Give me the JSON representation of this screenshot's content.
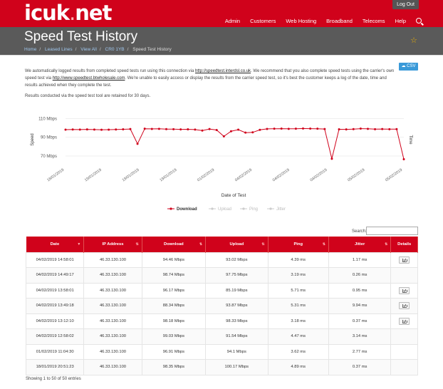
{
  "brand": {
    "logo_main": "icuk",
    "logo_dot": ".",
    "logo_tld": "net"
  },
  "topbar": {
    "logout_label": "Log Out"
  },
  "nav": {
    "items": [
      "Admin",
      "Customers",
      "Web Hosting",
      "Broadband",
      "Telecoms",
      "Help"
    ]
  },
  "page": {
    "title": "Speed Test History",
    "breadcrumb": [
      "Home",
      "Leased Lines",
      "View All",
      "CR0 1YB",
      "Speed Test History"
    ]
  },
  "intro": {
    "p1_a": "We automatically logged results from completed speed tests run using this connection via ",
    "link1": "http://speedtest.interdsl.co.uk",
    "p1_b": ". We recommend that you also complete speed tests using the carrier's own speed test via ",
    "link2": "http://www.speedtest.btwholesale.com",
    "p1_c": ". We're unable to easily access or display the results from the carrier speed test, so it's best the customer keeps a log of the date, time and results achieved when they complete the test.",
    "retention": "Results conducted via the speed test tool are retained for 30 days.",
    "csv_label": "CSV"
  },
  "chart_data": {
    "type": "line",
    "xlabel": "Date of Test",
    "ylabel": "Speed",
    "y2label": "Time",
    "yticks": [
      "70 Mbps",
      "90 Mbps",
      "110 Mbps"
    ],
    "ylim": [
      60,
      115
    ],
    "xticks": [
      "18/01/2019",
      "19/01/2019",
      "19/01/2019",
      "19/01/2019",
      "01/02/2019",
      "04/02/2019",
      "04/02/2019",
      "04/02/2019",
      "05/02/2019",
      "05/02/2019"
    ],
    "legend": [
      "Download",
      "Upload",
      "Ping",
      "Jitter"
    ],
    "series": [
      {
        "name": "Download",
        "color": "#d0021b",
        "values": [
          98.2,
          98.4,
          98.3,
          98.5,
          98.3,
          98.1,
          98.2,
          98.4,
          98.6,
          98.9,
          83.0,
          99.2,
          99.0,
          99.1,
          98.8,
          98.7,
          98.5,
          98.6,
          98.3,
          97.2,
          98.9,
          97.8,
          91.0,
          96.5,
          98.2,
          95.0,
          95.3,
          98.0,
          99.0,
          99.2,
          99.3,
          99.1,
          99.2,
          99.4,
          99.3,
          99.2,
          98.9,
          67.0,
          98.6,
          98.5,
          98.8,
          99.3,
          99.1,
          98.7,
          98.9,
          98.7,
          98.8,
          66.5
        ]
      }
    ]
  },
  "table": {
    "search_label": "Search:",
    "headers": [
      "Date",
      "IP Address",
      "Download",
      "Upload",
      "Ping",
      "Jitter",
      "Details"
    ],
    "rows": [
      [
        "04/02/2019 14:58:01",
        "46.33.130.100",
        "94.46 Mbps",
        "93.02 Mbps",
        "4.39 ms",
        "1.17 ms"
      ],
      [
        "04/02/2019 14:49:17",
        "46.33.130.100",
        "98.74 Mbps",
        "97.75 Mbps",
        "3.19 ms",
        "0.26 ms"
      ],
      [
        "04/02/2019 13:58:01",
        "46.33.130.100",
        "96.17 Mbps",
        "85.19 Mbps",
        "5.71 ms",
        "0.95 ms"
      ],
      [
        "04/02/2019 13:49:18",
        "46.33.130.100",
        "88.34 Mbps",
        "93.87 Mbps",
        "5.31 ms",
        "9.94 ms"
      ],
      [
        "04/02/2019 13:12:10",
        "46.33.130.100",
        "98.18 Mbps",
        "98.33 Mbps",
        "3.18 ms",
        "0.37 ms"
      ],
      [
        "04/02/2019 12:58:02",
        "46.33.130.100",
        "99.03 Mbps",
        "91.54 Mbps",
        "4.47 ms",
        "3.14 ms"
      ],
      [
        "01/02/2019 11:04:30",
        "46.33.130.100",
        "96.91 Mbps",
        "94.1 Mbps",
        "3.62 ms",
        "2.77 ms"
      ],
      [
        "18/01/2019 20:51:23",
        "46.33.130.100",
        "98.35 Mbps",
        "100.17 Mbps",
        "4.89 ms",
        "0.37 ms"
      ]
    ],
    "details_rows": [
      0,
      2,
      3,
      4
    ],
    "info": "Showing 1 to 50 of 50 entries"
  }
}
